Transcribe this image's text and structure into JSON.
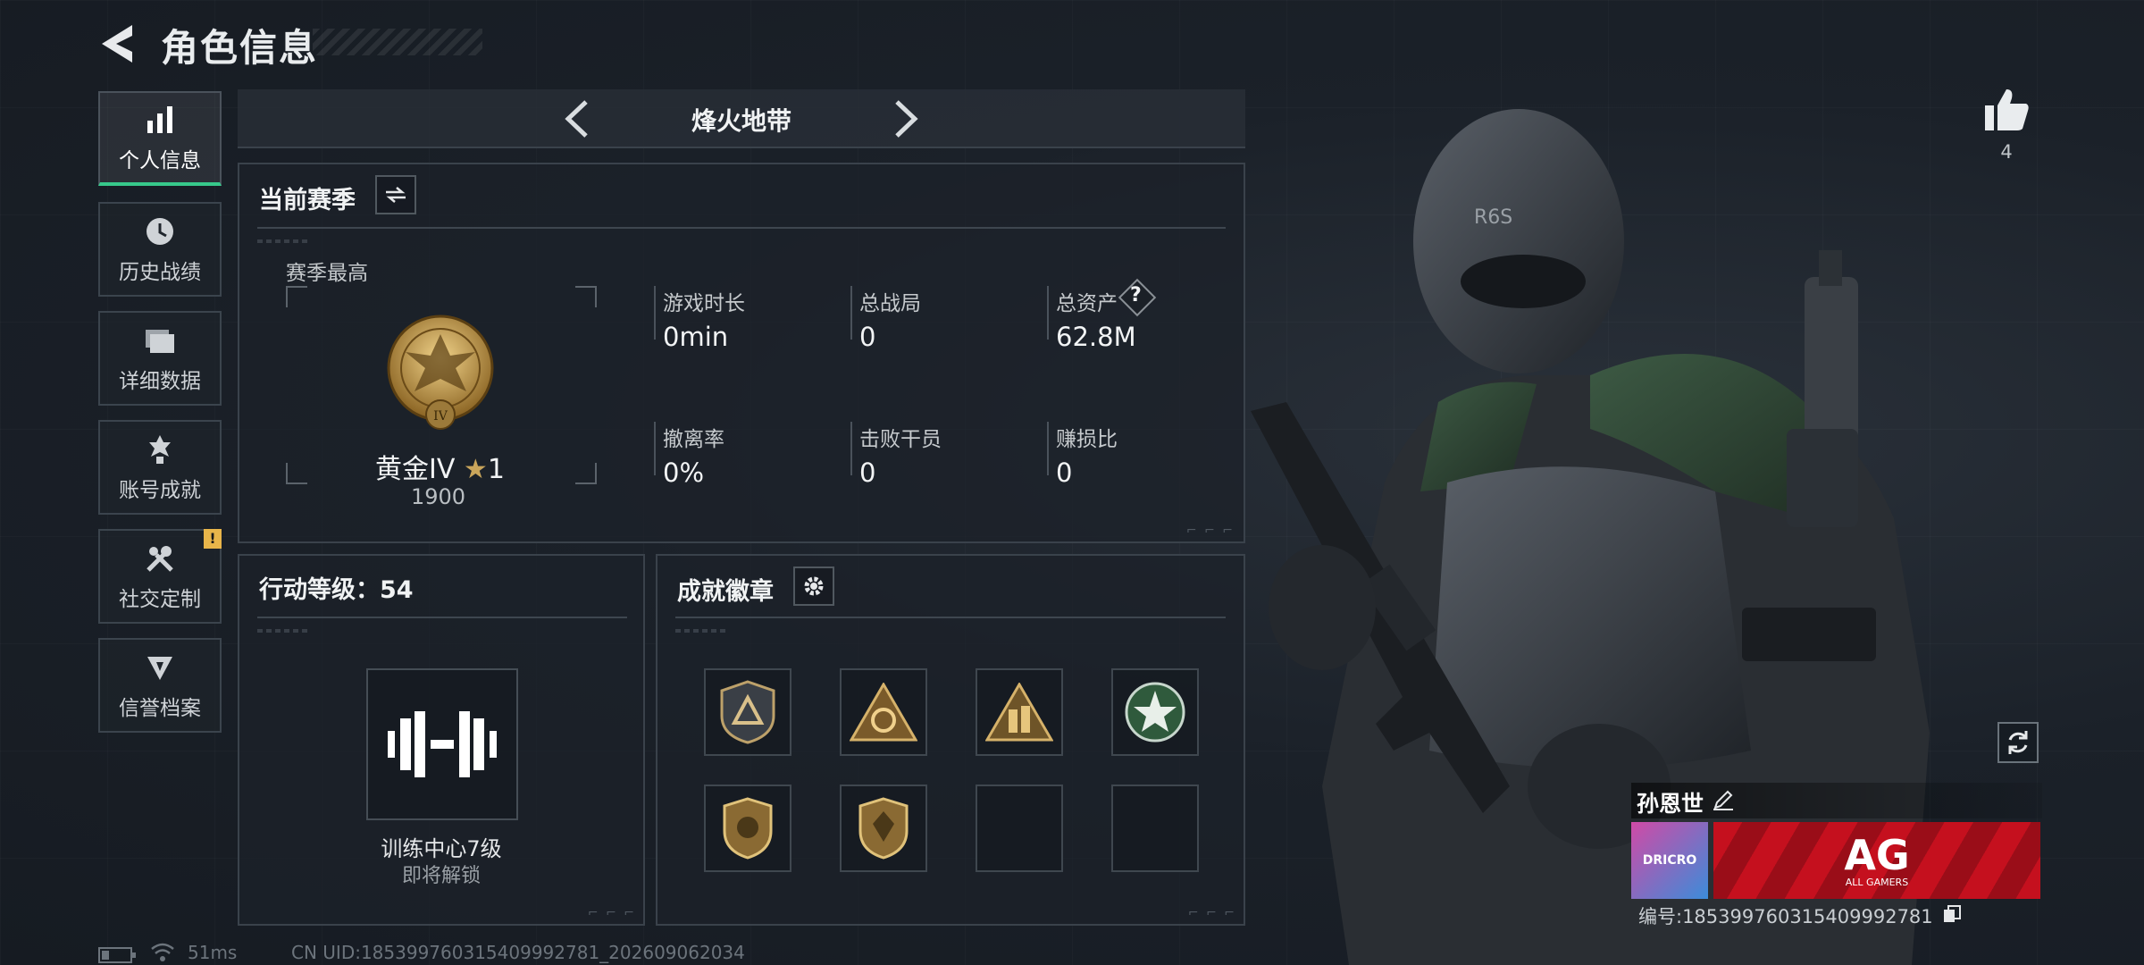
{
  "header": {
    "title": "角色信息"
  },
  "sidebar": {
    "items": [
      {
        "label": "个人信息",
        "icon": "bar-chart-icon",
        "active": true
      },
      {
        "label": "历史战绩",
        "icon": "history-clock-icon",
        "active": false
      },
      {
        "label": "详细数据",
        "icon": "folder-icon",
        "active": false
      },
      {
        "label": "账号成就",
        "icon": "achievement-icon",
        "active": false
      },
      {
        "label": "社交定制",
        "icon": "tools-icon",
        "active": false,
        "alert": "!"
      },
      {
        "label": "信誉档案",
        "icon": "credit-file-icon",
        "active": false
      }
    ]
  },
  "mode": {
    "name": "烽火地带"
  },
  "season": {
    "title": "当前赛季",
    "best_label": "赛季最高",
    "rank_name": "黄金IV",
    "rank_stars": "1",
    "rank_score": "1900",
    "stats": [
      {
        "label": "游戏时长",
        "value": "0min"
      },
      {
        "label": "总战局",
        "value": "0"
      },
      {
        "label": "总资产",
        "value": "62.8M",
        "help": "?"
      },
      {
        "label": "撤离率",
        "value": "0%"
      },
      {
        "label": "击败干员",
        "value": "0"
      },
      {
        "label": "赚损比",
        "value": "0"
      }
    ]
  },
  "action_level": {
    "title": "行动等级：54",
    "unlock_name": "训练中心7级",
    "unlock_status": "即将解锁"
  },
  "achievements": {
    "title": "成就徽章",
    "slots": [
      {
        "filled": true,
        "icon": "shield-triangle-badge-icon"
      },
      {
        "filled": true,
        "icon": "triangle-gear-badge-icon"
      },
      {
        "filled": true,
        "icon": "triangle-soldiers-badge-icon"
      },
      {
        "filled": true,
        "icon": "green-star-wreath-badge-icon"
      },
      {
        "filled": true,
        "icon": "shield-wings-badge-icon"
      },
      {
        "filled": true,
        "icon": "shield-gem-badge-icon"
      },
      {
        "filled": false
      },
      {
        "filled": false
      }
    ]
  },
  "player": {
    "likes": "4",
    "name": "孙恩世",
    "id_text": "编号:1853997603154099927​81",
    "team_logo_text": "DRICRO",
    "team_banner_text": "AG",
    "team_banner_sub": "ALL GAMERS"
  },
  "status": {
    "ping": "51ms",
    "uid": "CN UID:1853997603154099927​81_202609062034"
  },
  "colors": {
    "accent_green": "#37c98b",
    "alert_yellow": "#e8b54a",
    "banner_red": "#c5101e"
  }
}
